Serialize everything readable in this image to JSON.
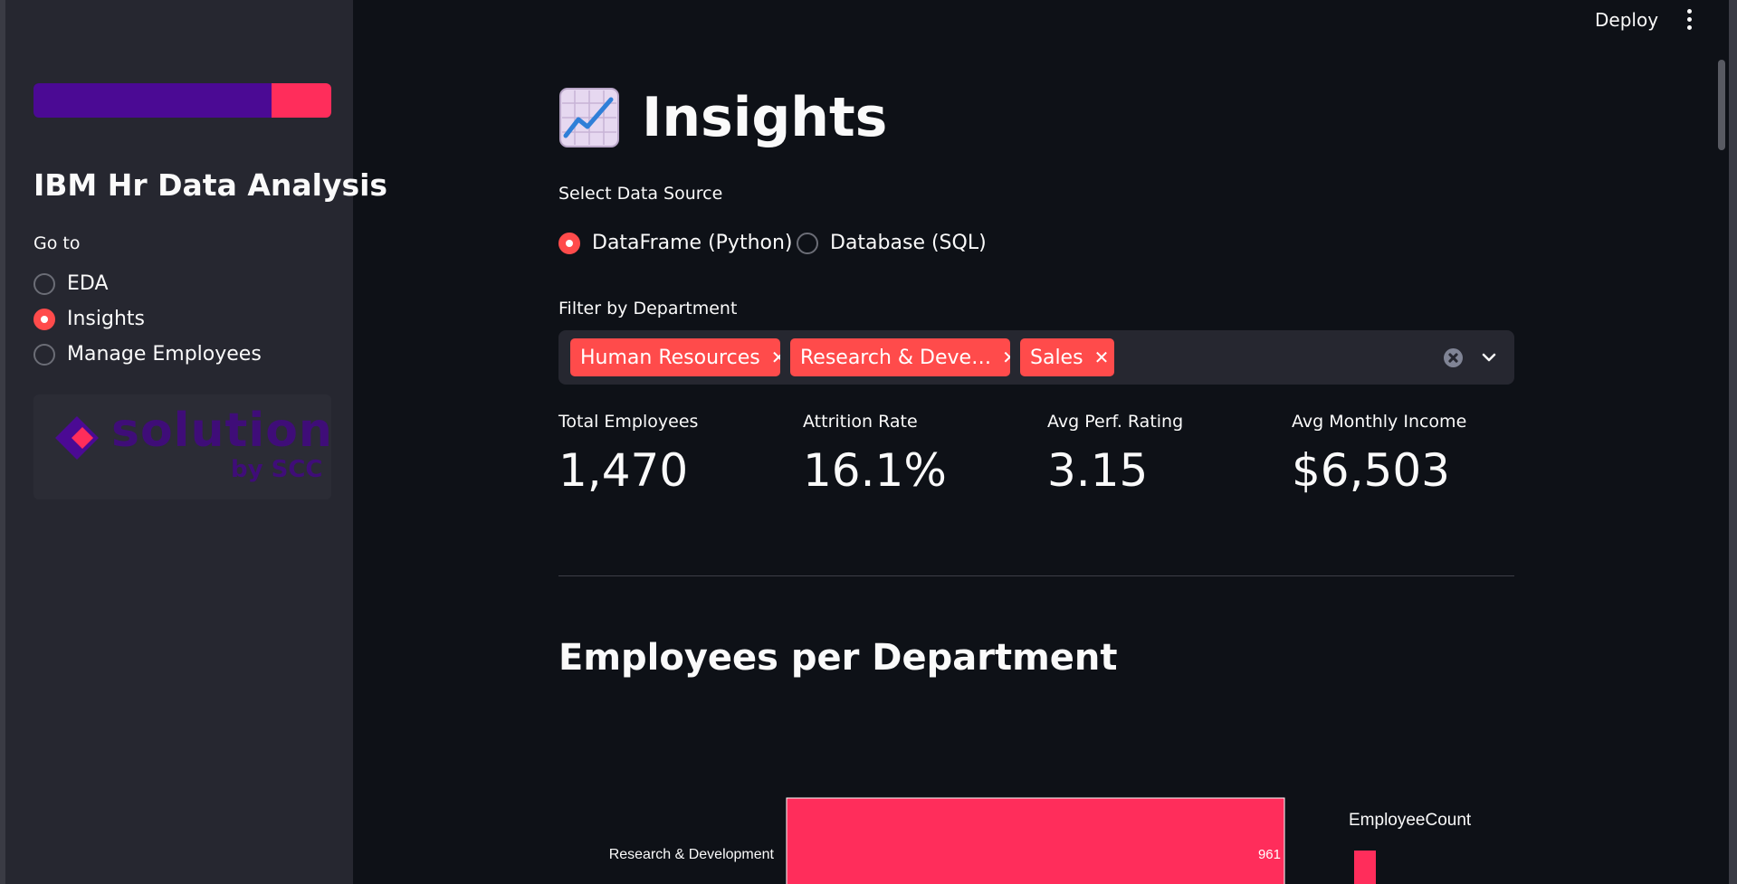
{
  "header": {
    "deploy_label": "Deploy"
  },
  "sidebar": {
    "title": "IBM Hr Data Analysis",
    "nav_label": "Go to",
    "nav_items": [
      {
        "label": "EDA",
        "selected": false
      },
      {
        "label": "Insights",
        "selected": true
      },
      {
        "label": "Manage Employees",
        "selected": false
      }
    ],
    "logo": {
      "text": "solutions",
      "subtext": "by SCC"
    }
  },
  "main": {
    "title": "Insights",
    "data_source": {
      "label": "Select Data Source",
      "options": [
        {
          "label": "DataFrame (Python)",
          "selected": true
        },
        {
          "label": "Database (SQL)",
          "selected": false
        }
      ]
    },
    "department_filter": {
      "label": "Filter by Department",
      "chips": [
        "Human Resources",
        "Research & Deve…",
        "Sales"
      ]
    },
    "metrics": [
      {
        "label": "Total Employees",
        "value": "1,470"
      },
      {
        "label": "Attrition Rate",
        "value": "16.1%"
      },
      {
        "label": "Avg Perf. Rating",
        "value": "3.15"
      },
      {
        "label": "Avg Monthly Income",
        "value": "$6,503"
      }
    ],
    "section_title": "Employees per Department"
  },
  "colors": {
    "accent": "#ff4b4b",
    "bar": "#ff2d5b",
    "background": "#0e1117",
    "sidebar": "#262730",
    "logo_purple": "#4b0a94"
  },
  "chart_data": {
    "type": "bar",
    "orientation": "horizontal",
    "categories": [
      "Research & Development"
    ],
    "values": [
      961
    ],
    "legend_title": "EmployeeCount",
    "data_labels": [
      "961"
    ]
  }
}
